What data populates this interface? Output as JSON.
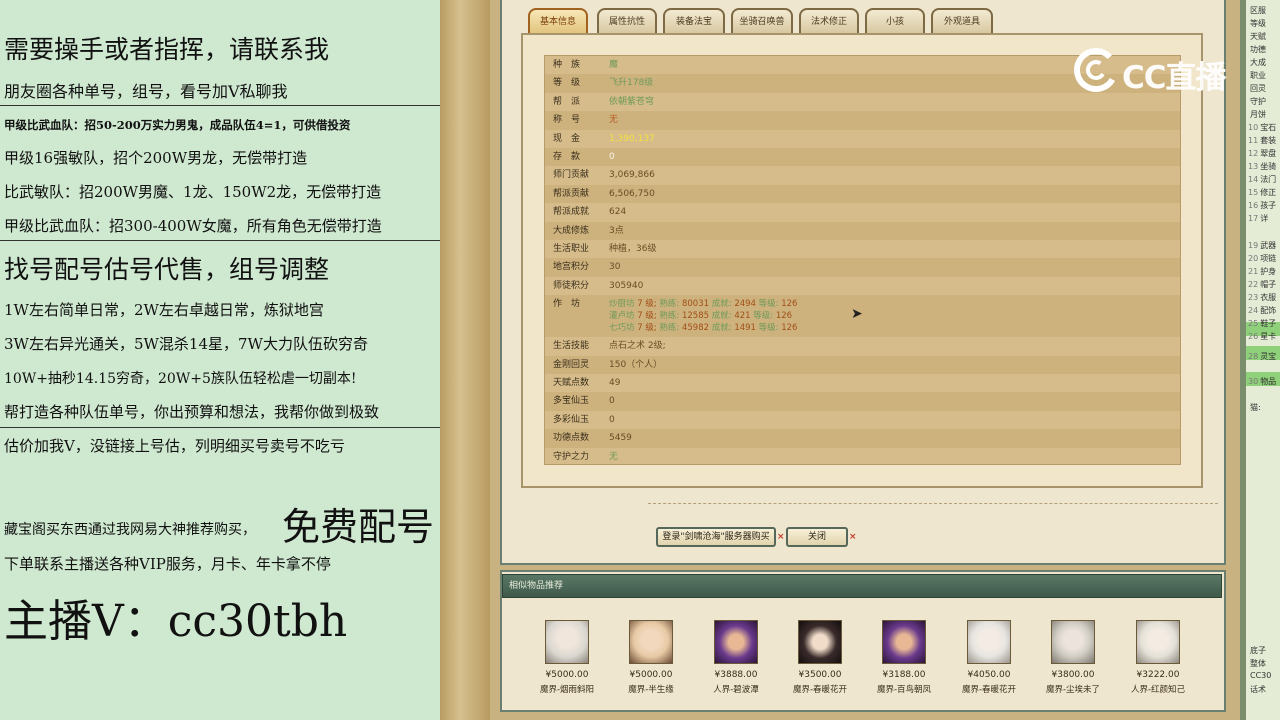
{
  "left_panel": {
    "lines": [
      "需要操手或者指挥，请联系我",
      "朋友圈各种单号，组号，看号加V私聊我",
      "甲级比武血队：招50-200万实力男鬼，成品队伍4=1，可供借投资",
      "甲级16强敏队，招个200W男龙，无偿带打造",
      "比武敏队：招200W男魔、1龙、150W2龙，无偿带打造",
      "甲级比武血队：招300-400W女魔，所有角色无偿带打造",
      "找号配号估号代售，组号调整",
      "1W左右简单日常，2W左右卓越日常，炼狱地宫",
      "3W左右异光通关，5W混杀14星，7W大力队伍砍穷奇",
      "10W+抽秒14.15穷奇，20W+5族队伍轻松虐一切副本!",
      "帮打造各种队伍单号，你出预算和想法，我帮你做到极致",
      "估价加我V，没链接上号估，列明细买号卖号不吃亏",
      "藏宝阁买东西通过我网易大神推荐购买，",
      "免费配号",
      "下单联系主播送各种VIP服务，月卡、年卡拿不停",
      "主播V：cc30tbh"
    ]
  },
  "tabs": [
    "基本信息",
    "属性抗性",
    "装备法宝",
    "坐骑召唤兽",
    "法术修正",
    "小孩",
    "外观道具"
  ],
  "info": {
    "rows": [
      {
        "label": "种　族",
        "value": "魔"
      },
      {
        "label": "等　级",
        "value": "飞升178级"
      },
      {
        "label": "帮　派",
        "value": "依朝紫苍穹"
      },
      {
        "label": "称　号",
        "value": "无"
      },
      {
        "label": "现　金",
        "value": "1,390,137"
      },
      {
        "label": "存　款",
        "value": "0"
      },
      {
        "label": "师门贡献",
        "value": "3,069,866"
      },
      {
        "label": "帮派贡献",
        "value": "6,506,750"
      },
      {
        "label": "帮派成就",
        "value": "624"
      },
      {
        "label": "大成修炼",
        "value": "3点"
      },
      {
        "label": "生活职业",
        "value": "种植，36级"
      },
      {
        "label": "地宫积分",
        "value": "30"
      },
      {
        "label": "师徒积分",
        "value": "305940"
      },
      {
        "label": "作　坊",
        "value": ""
      },
      {
        "label": "生活技能",
        "value": "点石之术 2级;"
      },
      {
        "label": "金刚回灵",
        "value": "150（个人）"
      },
      {
        "label": "天赋点数",
        "value": "49"
      },
      {
        "label": "多宝仙玉",
        "value": "0"
      },
      {
        "label": "多彩仙玉",
        "value": "0"
      },
      {
        "label": "功德点数",
        "value": "5459"
      },
      {
        "label": "守护之力",
        "value": "无"
      }
    ],
    "workshops": [
      {
        "name": "炒厨坊",
        "level_label": "7 级;",
        "k1": "熟练:",
        "v1": "80031",
        "k2": "成就:",
        "v2": "2494",
        "k3": "等级:",
        "v3": "126"
      },
      {
        "name": "灌卢坊",
        "level_label": "7 级;",
        "k1": "熟练:",
        "v1": "12585",
        "k2": "成就:",
        "v2": "421",
        "k3": "等级:",
        "v3": "126"
      },
      {
        "name": "七巧坊",
        "level_label": "7 级;",
        "k1": "熟练:",
        "v1": "45982",
        "k2": "成就:",
        "v2": "1491",
        "k3": "等级:",
        "v3": "126"
      }
    ]
  },
  "buttons": {
    "buy": "登录\"剑啸沧海\"服务器购买",
    "close": "关闭",
    "x_mark": "×"
  },
  "recommend": {
    "title": "相似物品推荐",
    "items": [
      {
        "price": "¥5000.00",
        "name": "魔界-烟雨斜阳",
        "color": "#d9d6cf"
      },
      {
        "price": "¥5000.00",
        "name": "魔界-半生缘",
        "color": "#e7c9a4"
      },
      {
        "price": "¥3888.00",
        "name": "人界-碧波潭",
        "color": "#6a3a8c"
      },
      {
        "price": "¥3500.00",
        "name": "魔界-春暖花开",
        "color": "#3a2b2b"
      },
      {
        "price": "¥3188.00",
        "name": "魔界-百鸟朝凤",
        "color": "#6a3a8c"
      },
      {
        "price": "¥4050.00",
        "name": "魔界-春暖花开",
        "color": "#e6e4e0"
      },
      {
        "price": "¥3800.00",
        "name": "魔界-尘埃未了",
        "color": "#d0ccc4"
      },
      {
        "price": "¥3222.00",
        "name": "人界-红颜知己",
        "color": "#e3e0d8"
      }
    ]
  },
  "right_strip": {
    "lines": [
      {
        "n": "",
        "t": "区服"
      },
      {
        "n": "",
        "t": "等级"
      },
      {
        "n": "",
        "t": "天赋"
      },
      {
        "n": "",
        "t": "功德"
      },
      {
        "n": "",
        "t": "大成"
      },
      {
        "n": "",
        "t": "职业"
      },
      {
        "n": "",
        "t": "回灵"
      },
      {
        "n": "",
        "t": "守护"
      },
      {
        "n": "",
        "t": "月饼"
      },
      {
        "n": "10",
        "t": "宝石"
      },
      {
        "n": "11",
        "t": "套装"
      },
      {
        "n": "12",
        "t": "翠盘"
      },
      {
        "n": "13",
        "t": "坐骑"
      },
      {
        "n": "14",
        "t": "法门"
      },
      {
        "n": "15",
        "t": "修正"
      },
      {
        "n": "16",
        "t": "孩子"
      },
      {
        "n": "17",
        "t": "详"
      },
      {
        "n": "19",
        "t": "武器"
      },
      {
        "n": "20",
        "t": "项链"
      },
      {
        "n": "21",
        "t": "护身"
      },
      {
        "n": "22",
        "t": "帽子"
      },
      {
        "n": "23",
        "t": "衣服"
      },
      {
        "n": "24",
        "t": "配饰"
      },
      {
        "n": "25",
        "t": "鞋子"
      },
      {
        "n": "26",
        "t": "星卡"
      },
      {
        "n": "28",
        "t": "灵宝"
      },
      {
        "n": "30",
        "t": "物品"
      },
      {
        "n": "",
        "t": "猫:"
      },
      {
        "n": "",
        "t": "底子"
      },
      {
        "n": "",
        "t": "整体"
      },
      {
        "n": "",
        "t": "CC30"
      },
      {
        "n": "",
        "t": "话术"
      }
    ]
  },
  "watermark": {
    "text": "CC直播"
  }
}
